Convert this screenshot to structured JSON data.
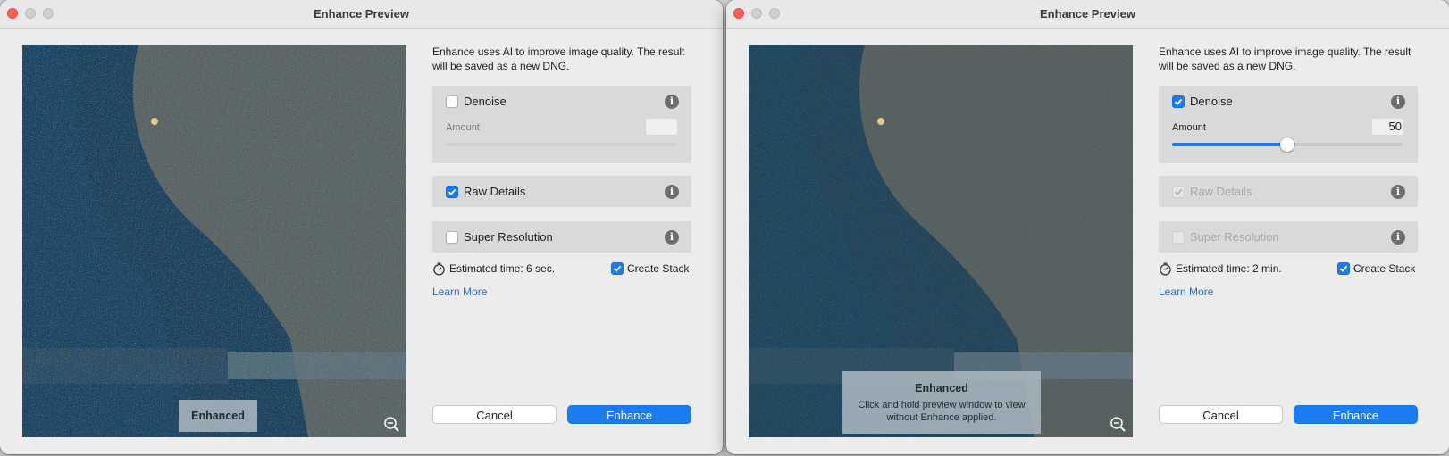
{
  "windows": [
    {
      "title": "Enhance Preview",
      "description": "Enhance uses AI to improve image quality. The result will be saved as a new DNG.",
      "denoise": {
        "label": "Denoise",
        "checked": false,
        "amount_label": "Amount",
        "amount_value": ""
      },
      "raw_details": {
        "label": "Raw Details",
        "checked": true,
        "disabled": false
      },
      "super_resolution": {
        "label": "Super Resolution",
        "checked": false,
        "disabled": false
      },
      "estimated_time": "Estimated time: 6 sec.",
      "create_stack": {
        "label": "Create Stack",
        "checked": true
      },
      "learn_more": "Learn More",
      "cancel": "Cancel",
      "enhance": "Enhance",
      "badge": {
        "title": "Enhanced",
        "text": ""
      }
    },
    {
      "title": "Enhance Preview",
      "description": "Enhance uses AI to improve image quality. The result will be saved as a new DNG.",
      "denoise": {
        "label": "Denoise",
        "checked": true,
        "amount_label": "Amount",
        "amount_value": "50",
        "slider_fraction": 0.5
      },
      "raw_details": {
        "label": "Raw Details",
        "checked": true,
        "disabled": true
      },
      "super_resolution": {
        "label": "Super Resolution",
        "checked": false,
        "disabled": true
      },
      "estimated_time": "Estimated time: 2 min.",
      "create_stack": {
        "label": "Create Stack",
        "checked": true
      },
      "learn_more": "Learn More",
      "cancel": "Cancel",
      "enhance": "Enhance",
      "badge": {
        "title": "Enhanced",
        "text": "Click and hold preview window to view without Enhance applied."
      }
    }
  ],
  "colors": {
    "accent": "#1a7bf2",
    "link": "#2a6ed6",
    "close": "#ff5f57"
  },
  "icons": [
    "close-icon",
    "minimize-icon",
    "maximize-icon",
    "info-icon",
    "zoom-out-icon",
    "timer-icon",
    "checkmark-icon"
  ]
}
